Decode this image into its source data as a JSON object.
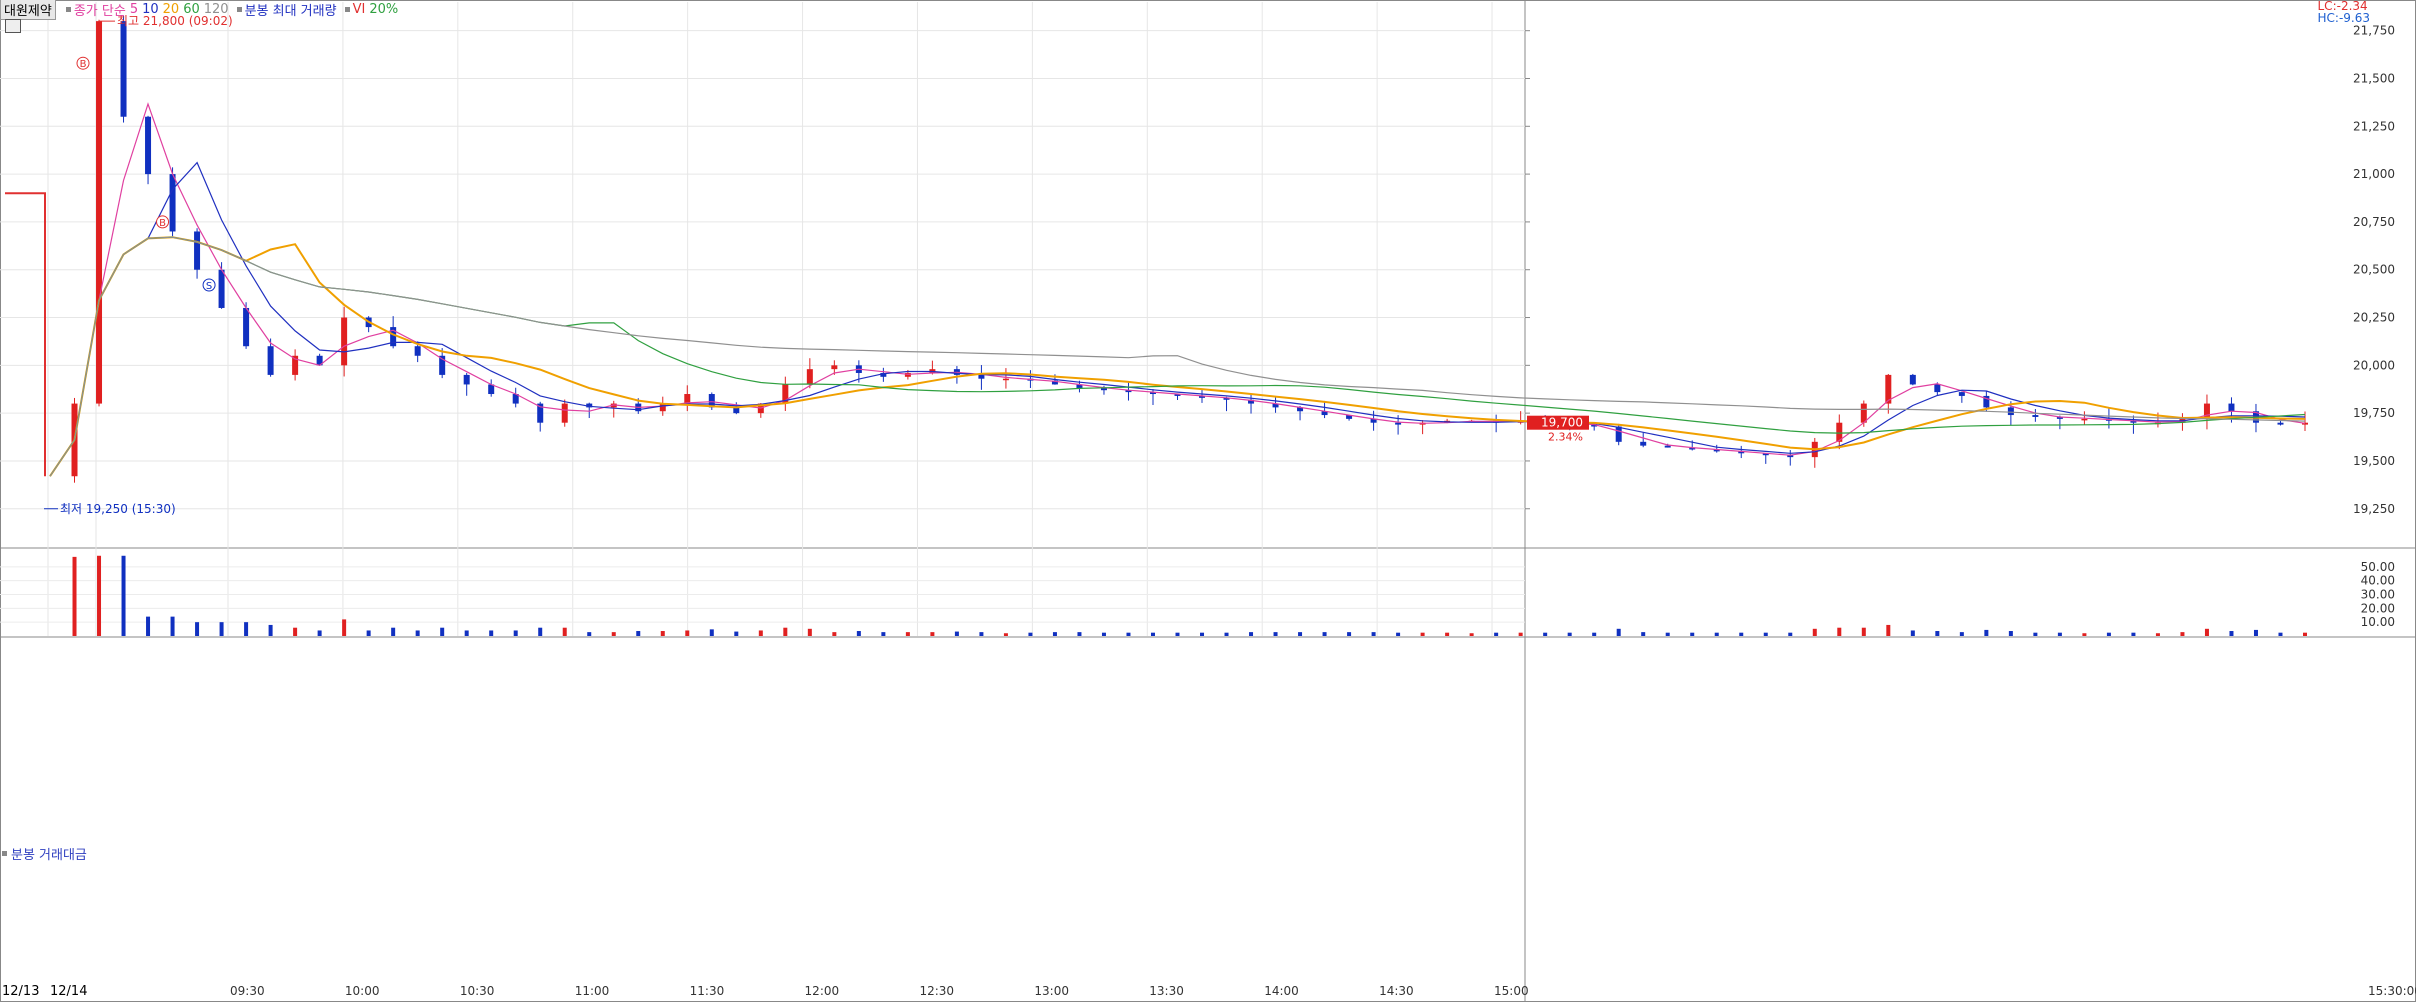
{
  "chart_data": {
    "type": "candlestick",
    "stock_name": "대원제약",
    "legend": {
      "price_ma_label": "종가 단순",
      "ma_periods": [
        {
          "label": "5",
          "color": "#e040a0"
        },
        {
          "label": "10",
          "color": "#2030c0"
        },
        {
          "label": "20",
          "color": "#f0a000"
        },
        {
          "label": "60",
          "color": "#30a040"
        },
        {
          "label": "120",
          "color": "#909090"
        }
      ],
      "max_volume_label": "분봉 최대 거래량",
      "vi_label": "VI",
      "vi_value": "20%"
    },
    "lc_label": "LC:-2.34",
    "hc_label": "HC:-9.63",
    "y_axis": {
      "ticks": [
        "21,750",
        "21,500",
        "21,250",
        "21,000",
        "20,750",
        "20,500",
        "20,250",
        "20,000",
        "19,750",
        "19,500",
        "19,250"
      ],
      "ylim": [
        19050,
        21900
      ]
    },
    "x_axis": {
      "date_labels": [
        "12/13",
        "12/14"
      ],
      "time_labels": [
        "09:30",
        "10:00",
        "10:30",
        "11:00",
        "11:30",
        "12:00",
        "12:30",
        "13:00",
        "13:30",
        "14:00",
        "14:30",
        "15:00",
        "15:30:00"
      ]
    },
    "annotations": {
      "high": "최고 21,800 (09:02)",
      "low": "최저 19,250 (15:30)",
      "sell_marker": "S",
      "buy_marker": "B"
    },
    "current_price": "19,700",
    "current_change": "2.34%",
    "previous_close": 20900,
    "volume_panel": {
      "title": "분봉 거래대금",
      "ticks": [
        "50.00",
        "40.00",
        "30.00",
        "20.00",
        "10.00"
      ],
      "ylim": [
        0,
        60
      ]
    },
    "price_path": [
      [
        0,
        19420
      ],
      [
        1,
        19800
      ],
      [
        2,
        21800
      ],
      [
        3,
        21300
      ],
      [
        4,
        21000
      ],
      [
        5,
        20700
      ],
      [
        6,
        20500
      ],
      [
        7,
        20300
      ],
      [
        8,
        20100
      ],
      [
        9,
        19950
      ],
      [
        10,
        20050
      ],
      [
        11,
        20000
      ],
      [
        12,
        20250
      ],
      [
        13,
        20200
      ],
      [
        14,
        20100
      ],
      [
        15,
        20050
      ],
      [
        16,
        19950
      ],
      [
        17,
        19900
      ],
      [
        18,
        19850
      ],
      [
        19,
        19800
      ],
      [
        20,
        19700
      ],
      [
        21,
        19800
      ],
      [
        22,
        19780
      ],
      [
        23,
        19800
      ],
      [
        24,
        19760
      ],
      [
        25,
        19800
      ],
      [
        26,
        19850
      ],
      [
        27,
        19780
      ],
      [
        28,
        19750
      ],
      [
        29,
        19800
      ],
      [
        30,
        19900
      ],
      [
        31,
        19980
      ],
      [
        32,
        20000
      ],
      [
        33,
        19960
      ],
      [
        34,
        19940
      ],
      [
        35,
        19960
      ],
      [
        36,
        19980
      ],
      [
        37,
        19950
      ],
      [
        38,
        19930
      ],
      [
        39,
        19930
      ],
      [
        40,
        19920
      ],
      [
        41,
        19900
      ],
      [
        42,
        19880
      ],
      [
        43,
        19870
      ],
      [
        44,
        19860
      ],
      [
        45,
        19850
      ],
      [
        46,
        19840
      ],
      [
        47,
        19830
      ],
      [
        48,
        19820
      ],
      [
        49,
        19800
      ],
      [
        50,
        19780
      ],
      [
        51,
        19760
      ],
      [
        52,
        19740
      ],
      [
        53,
        19720
      ],
      [
        54,
        19700
      ],
      [
        55,
        19690
      ],
      [
        56,
        19700
      ],
      [
        57,
        19710
      ],
      [
        58,
        19710
      ],
      [
        59,
        19700
      ],
      [
        60,
        19710
      ],
      [
        61,
        19700
      ],
      [
        62,
        19690
      ],
      [
        63,
        19680
      ],
      [
        64,
        19600
      ],
      [
        65,
        19580
      ],
      [
        66,
        19570
      ],
      [
        67,
        19560
      ],
      [
        68,
        19550
      ],
      [
        69,
        19540
      ],
      [
        70,
        19530
      ],
      [
        71,
        19520
      ],
      [
        72,
        19600
      ],
      [
        73,
        19700
      ],
      [
        74,
        19800
      ],
      [
        75,
        19950
      ],
      [
        76,
        19900
      ],
      [
        77,
        19860
      ],
      [
        78,
        19840
      ],
      [
        79,
        19780
      ],
      [
        80,
        19740
      ],
      [
        81,
        19730
      ],
      [
        82,
        19720
      ],
      [
        83,
        19720
      ],
      [
        84,
        19710
      ],
      [
        85,
        19700
      ],
      [
        86,
        19700
      ],
      [
        87,
        19720
      ],
      [
        88,
        19800
      ],
      [
        89,
        19760
      ],
      [
        90,
        19700
      ],
      [
        91,
        19690
      ],
      [
        92,
        19700
      ]
    ]
  }
}
